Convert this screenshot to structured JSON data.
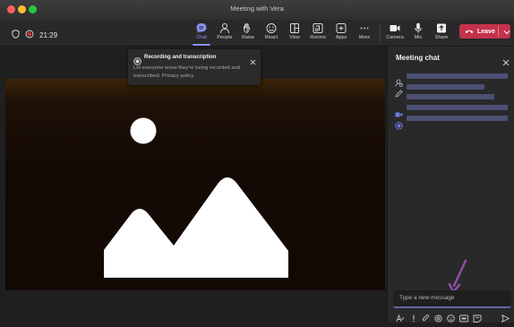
{
  "window": {
    "title": "Meeting with Vera"
  },
  "toolbar": {
    "timer": "21:29",
    "tools": [
      {
        "label": "Chat",
        "icon": "chat-icon",
        "active": true
      },
      {
        "label": "People",
        "icon": "people-icon"
      },
      {
        "label": "Raise",
        "icon": "raise-hand-icon"
      },
      {
        "label": "React",
        "icon": "react-icon"
      },
      {
        "label": "View",
        "icon": "view-icon"
      },
      {
        "label": "Rooms",
        "icon": "rooms-icon"
      },
      {
        "label": "Apps",
        "icon": "apps-icon"
      },
      {
        "label": "More",
        "icon": "more-icon"
      },
      {
        "label": "Camera",
        "icon": "camera-icon"
      },
      {
        "label": "Mic",
        "icon": "mic-icon"
      },
      {
        "label": "Share",
        "icon": "share-icon"
      }
    ],
    "leave_label": "Leave"
  },
  "toast": {
    "title": "Recording and transcription",
    "body": "Let everyone know they're being recorded and transcribed. Privacy policy"
  },
  "chat": {
    "title": "Meeting chat",
    "composer_placeholder": "Type a new message"
  },
  "colors": {
    "accent": "#8b8ff5",
    "leave": "#c4314b",
    "annotation_arrow": "#8e4fa8"
  }
}
